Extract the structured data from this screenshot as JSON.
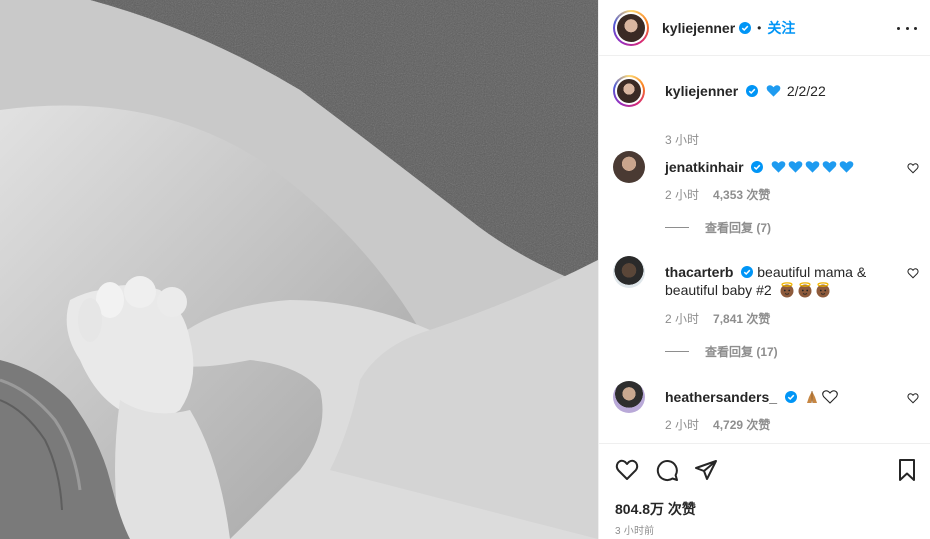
{
  "post": {
    "image_description_icon": "photo-hands-icon"
  },
  "header": {
    "username": "kyliejenner",
    "separator": "•",
    "follow_label": "关注",
    "more_icon": "more-horizontal-icon"
  },
  "caption": {
    "username": "kyliejenner",
    "text": "2/2/22",
    "time": "3 小时"
  },
  "comments": [
    {
      "username": "jenatkinhair",
      "text": "",
      "time": "2 小时",
      "likes": "4,353 次赞",
      "replies_label": "查看回复 (7)"
    },
    {
      "username": "thacarterb",
      "text": "beautiful mama & beautiful baby #2",
      "time": "2 小时",
      "likes": "7,841 次赞",
      "replies_label": "查看回复 (17)"
    },
    {
      "username": "heathersanders_",
      "text": "",
      "time": "2 小时",
      "likes": "4,729 次赞"
    }
  ],
  "footer": {
    "likes": "804.8万 次赞",
    "time_ago": "3 小时前"
  },
  "colors": {
    "accent": "#0095f6",
    "text": "#262626",
    "muted": "#8e8e8e",
    "emoji_heart": "#1e9bf0"
  }
}
